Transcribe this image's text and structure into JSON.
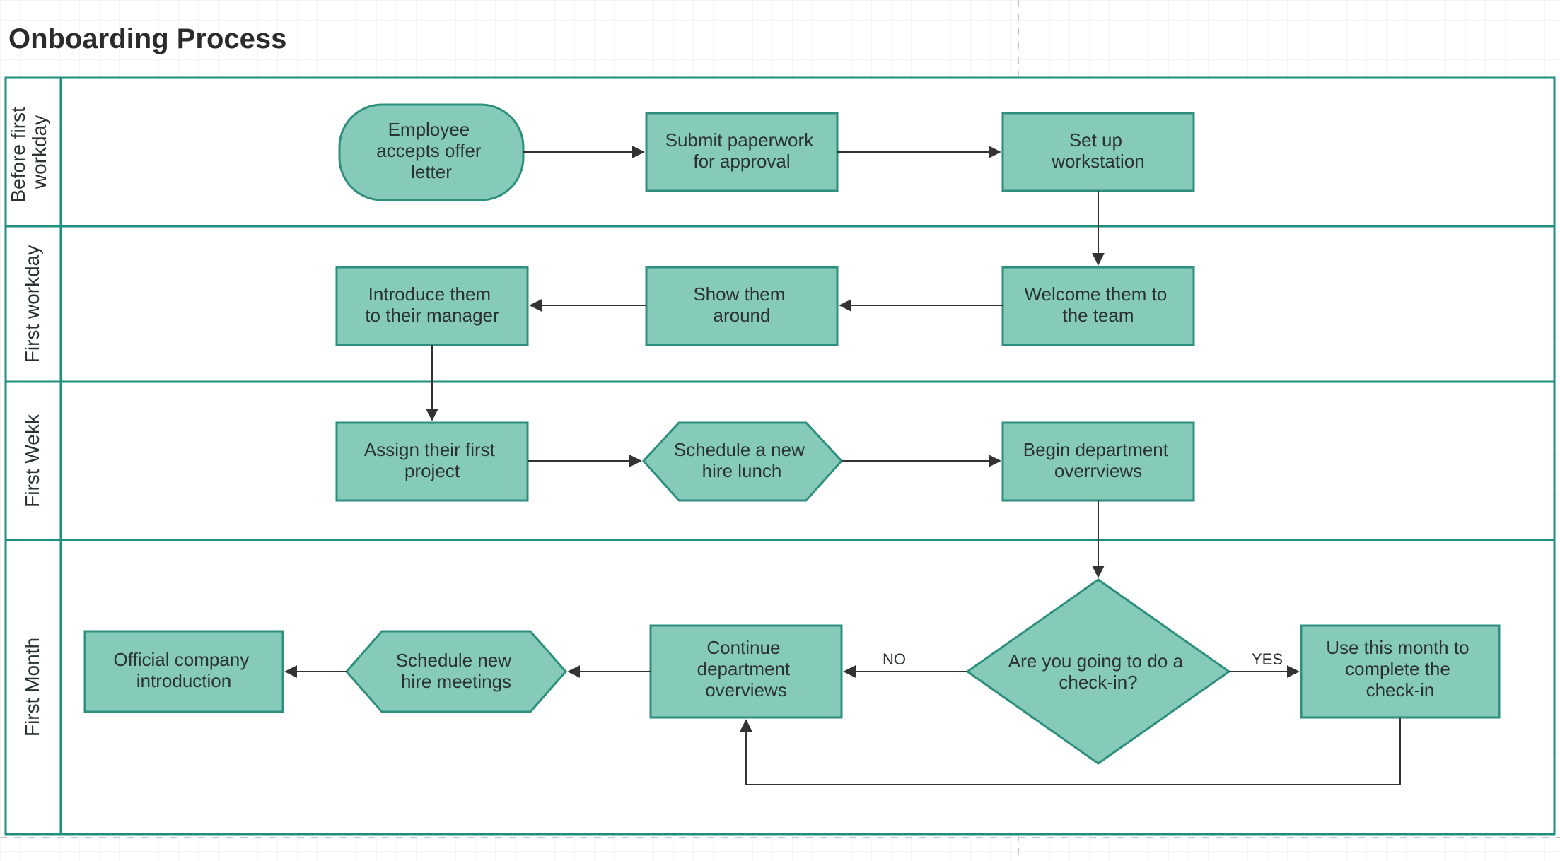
{
  "title": "Onboarding Process",
  "swimlanes": [
    {
      "label": "Before first workday"
    },
    {
      "label": "First workday"
    },
    {
      "label": "First Wekk"
    },
    {
      "label": "First Month"
    }
  ],
  "nodes": {
    "accept": {
      "lines": [
        "Employee",
        "accepts offer",
        "letter"
      ]
    },
    "paperwork": {
      "lines": [
        "Submit paperwork",
        "for approval"
      ]
    },
    "wkstn": {
      "lines": [
        "Set up",
        "workstation"
      ]
    },
    "welcome": {
      "lines": [
        "Welcome them to",
        "the team"
      ]
    },
    "tour": {
      "lines": [
        "Show them",
        "around"
      ]
    },
    "intro_mgr": {
      "lines": [
        "Introduce them",
        "to their manager"
      ]
    },
    "assign": {
      "lines": [
        "Assign their first",
        "project"
      ]
    },
    "lunch": {
      "lines": [
        "Schedule a new",
        "hire lunch"
      ]
    },
    "overview": {
      "lines": [
        "Begin department",
        "overrviews"
      ]
    },
    "checkin_q": {
      "lines": [
        "Are you going to do a",
        "check-in?"
      ]
    },
    "use_month": {
      "lines": [
        "Use this month to",
        "complete the",
        "check-in"
      ]
    },
    "continue": {
      "lines": [
        "Continue",
        "department",
        "overviews"
      ]
    },
    "meetings": {
      "lines": [
        "Schedule new",
        "hire meetings"
      ]
    },
    "company": {
      "lines": [
        "Official company",
        "introduction"
      ]
    }
  },
  "edge_labels": {
    "no": "NO",
    "yes": "YES"
  },
  "colors": {
    "fill": "#86CBB9",
    "stroke_dark": "#1E8F7E",
    "stroke_node": "#2E8F7E",
    "arrow": "#333333",
    "grid": "#E9ECED",
    "frame": "#1E8F7E"
  }
}
